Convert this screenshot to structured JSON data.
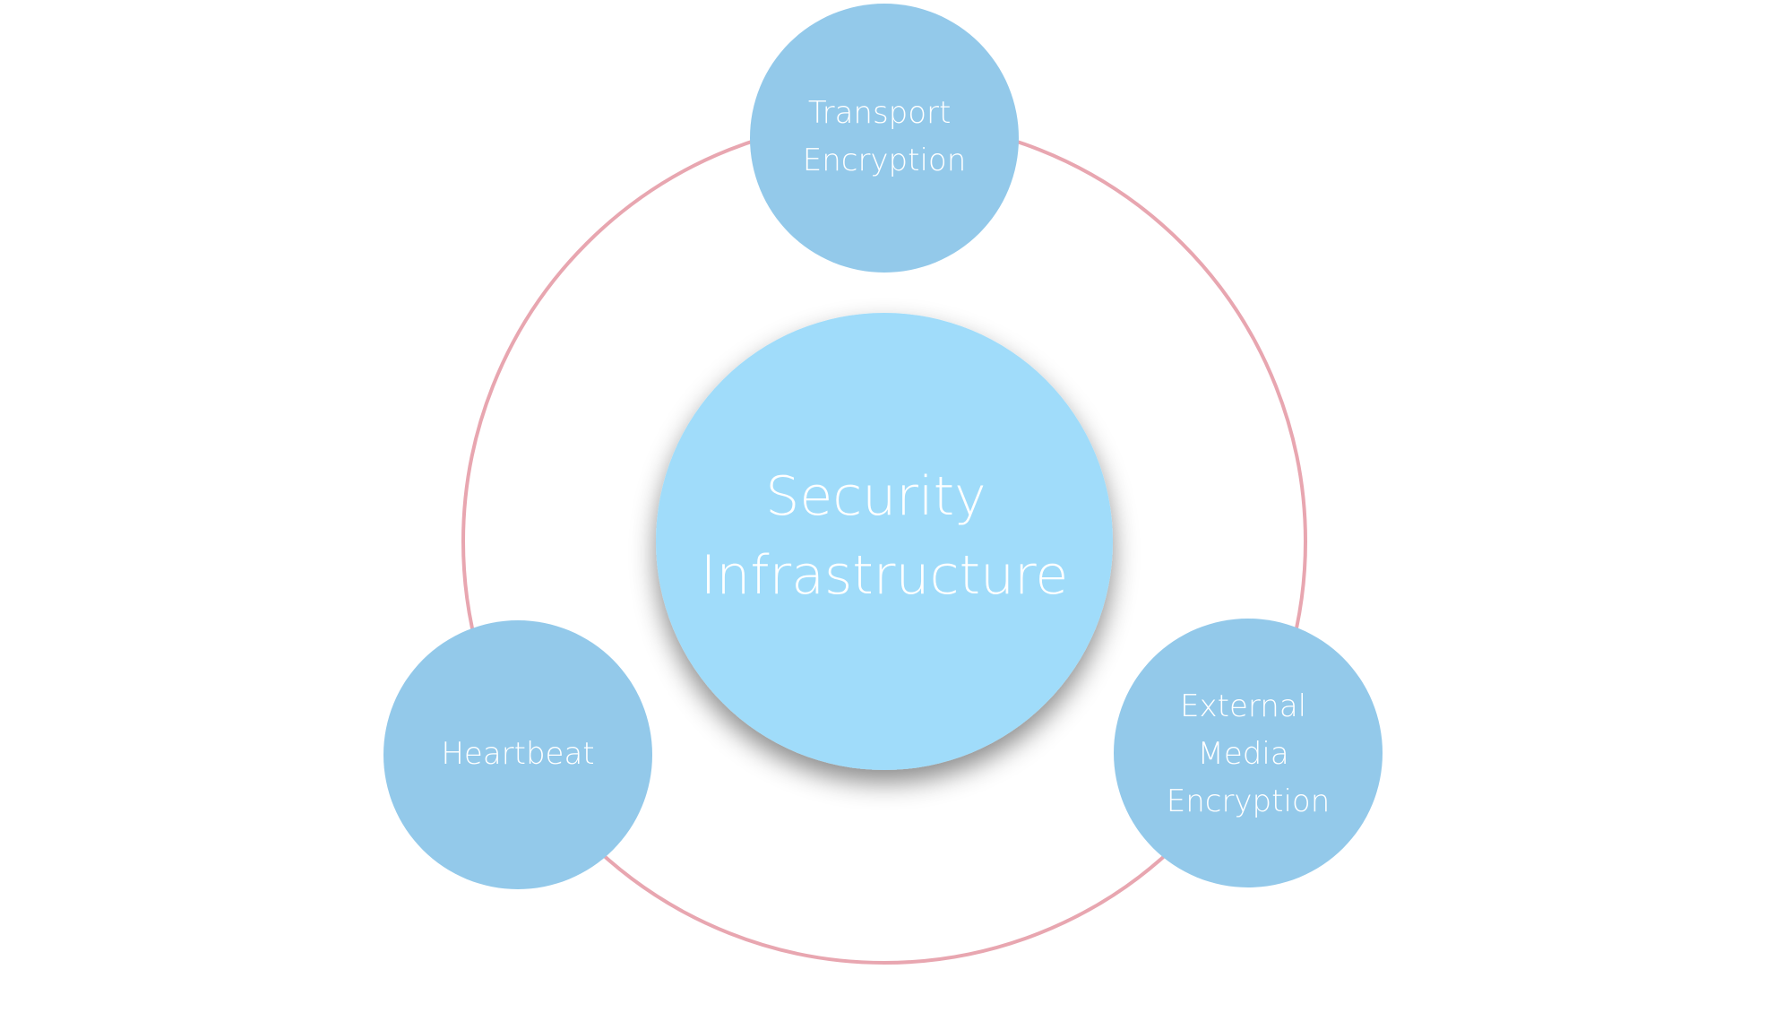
{
  "colors": {
    "ring": "#e8a6b0",
    "outer_node_fill": "#93c9ea",
    "center_node_fill": "#a0dcfa",
    "label_text": "#ffffff",
    "background": "#ffffff"
  },
  "center_node": {
    "lines": [
      "Security",
      "Infrastructure"
    ]
  },
  "outer_nodes": [
    {
      "id": "transport",
      "lines": [
        "Transport",
        "Encryption"
      ]
    },
    {
      "id": "media",
      "lines": [
        "External",
        "Media",
        "Encryption"
      ]
    },
    {
      "id": "heartbeat",
      "lines": [
        "Heartbeat"
      ]
    }
  ]
}
